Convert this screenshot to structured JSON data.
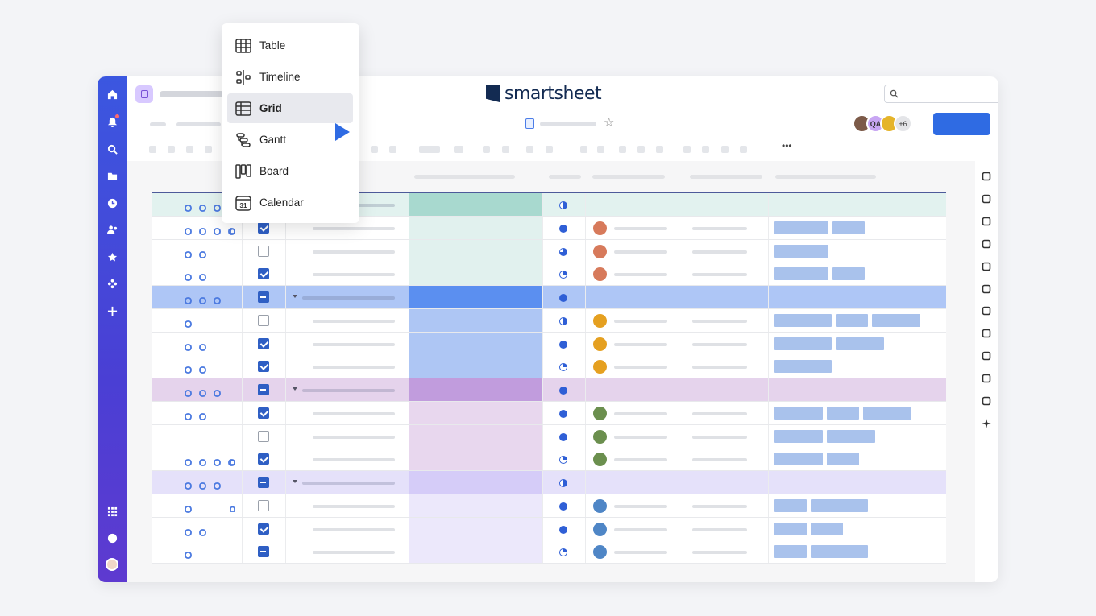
{
  "app": {
    "logo_text": "smartsheet"
  },
  "view_menu": {
    "items": [
      {
        "label": "Table",
        "icon": "table-icon"
      },
      {
        "label": "Timeline",
        "icon": "timeline-icon"
      },
      {
        "label": "Grid",
        "icon": "grid-icon",
        "selected": true
      },
      {
        "label": "Gantt",
        "icon": "gantt-icon"
      },
      {
        "label": "Board",
        "icon": "board-icon"
      },
      {
        "label": "Calendar",
        "icon": "calendar-icon",
        "badge": "31"
      }
    ]
  },
  "collaborators": {
    "initials": "QA",
    "overflow": "+6"
  },
  "colors": {
    "primary": "#2f6be3",
    "nav_top": "#3b57e0",
    "nav_bottom": "#5e3ad0",
    "check": "#2f5fc4",
    "tag": "#a9c2ec"
  },
  "grid": {
    "rows": [
      {
        "bg": "#e2f2ef",
        "color": "#a8d9cf",
        "check": "none",
        "icons": 3,
        "status": "half",
        "group": true,
        "tags": []
      },
      {
        "bg": "#fff",
        "color": "#e1f1ee",
        "check": "on",
        "icons": 4,
        "status": "full",
        "av": "#d77a5b",
        "tags": [
          67,
          40
        ]
      },
      {
        "bg": "#fff",
        "color": "#e1f1ee",
        "check": "off",
        "icons": 2,
        "status": "three",
        "av": "#d77a5b",
        "tags": [
          67
        ]
      },
      {
        "bg": "#fff",
        "color": "#e1f1ee",
        "check": "on",
        "icons": 2,
        "status": "quarter",
        "av": "#d77a5b",
        "tags": [
          67,
          40
        ]
      },
      {
        "bg": "#aec6f6",
        "color": "#5b8ff0",
        "check": "ind",
        "icons": 3,
        "status": "full",
        "group": true,
        "tags": []
      },
      {
        "bg": "#fff",
        "color": "#aec6f4",
        "check": "off",
        "icons": 1,
        "status": "half",
        "av": "#e5a020",
        "tags": [
          71,
          40,
          60
        ]
      },
      {
        "bg": "#fff",
        "color": "#aec6f4",
        "check": "on",
        "icons": 2,
        "status": "full",
        "av": "#e5a020",
        "tags": [
          71,
          60
        ]
      },
      {
        "bg": "#fff",
        "color": "#aec6f4",
        "check": "on",
        "icons": 2,
        "status": "quarter",
        "av": "#e5a020",
        "tags": [
          71
        ]
      },
      {
        "bg": "#e5d3ec",
        "color": "#c19cdd",
        "check": "ind",
        "icons": 3,
        "status": "full",
        "group": true,
        "tags": []
      },
      {
        "bg": "#fff",
        "color": "#e8d7ee",
        "check": "on",
        "icons": 2,
        "status": "full",
        "av": "#6b8f4e",
        "tags": [
          60,
          40,
          60
        ]
      },
      {
        "bg": "#fff",
        "color": "#e8d7ee",
        "check": "off",
        "icons": 0,
        "status": "full",
        "av": "#6b8f4e",
        "tags": [
          60,
          60
        ]
      },
      {
        "bg": "#fff",
        "color": "#e8d7ee",
        "check": "on",
        "icons": 4,
        "status": "quarter",
        "av": "#6b8f4e",
        "tags": [
          60,
          40
        ]
      },
      {
        "bg": "#e5e1fa",
        "color": "#d5ccf8",
        "check": "ind",
        "icons": 3,
        "status": "half",
        "group": true,
        "tags": []
      },
      {
        "bg": "#fff",
        "color": "#ece8fb",
        "check": "off",
        "icons": 5,
        "status": "full",
        "av": "#4f86c6",
        "tags": [
          40,
          71
        ]
      },
      {
        "bg": "#fff",
        "color": "#ece8fb",
        "check": "on",
        "icons": 2,
        "status": "full",
        "av": "#4f86c6",
        "tags": [
          40,
          40
        ]
      },
      {
        "bg": "#fff",
        "color": "#ece8fb",
        "check": "ind",
        "icons": 1,
        "status": "quarter",
        "av": "#4f86c6",
        "tags": [
          40,
          71
        ]
      }
    ]
  }
}
